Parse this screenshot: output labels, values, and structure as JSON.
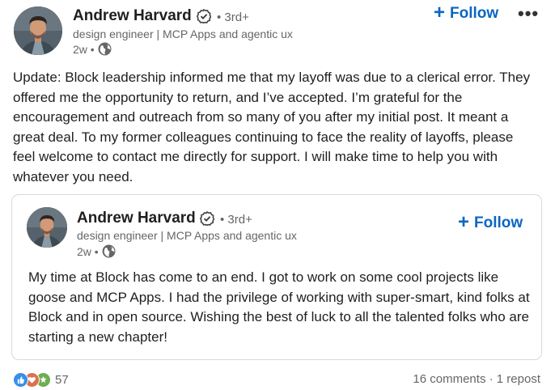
{
  "post": {
    "author": {
      "name": "Andrew Harvard",
      "degree": "• 3rd+",
      "headline": "design engineer | MCP Apps and agentic ux",
      "time": "2w •"
    },
    "follow_label": "Follow",
    "more_label": "•••",
    "text": "Update: Block leadership informed me that my layoff was due to a clerical error. They offered me the opportunity to return, and I’ve accepted. I’m grateful for the encouragement and outreach from so many of you after my initial post. It meant a great deal. To my former colleagues continuing to face the reality of layoffs, please feel welcome to contact me directly for support. I will make time to help you with whatever you need."
  },
  "shared_post": {
    "author": {
      "name": "Andrew Harvard",
      "degree": "• 3rd+",
      "headline": "design engineer | MCP Apps and agentic ux",
      "time": "2w •"
    },
    "follow_label": "Follow",
    "text": "My time at Block has come to an end. I got to work on some cool projects like goose and MCP Apps. I had the privilege of working with super-smart, kind folks at Block and in open source. Wishing the best of luck to all the talented folks who are starting a new chapter!"
  },
  "social": {
    "reaction_icons": [
      "like-icon",
      "love-icon",
      "support-icon"
    ],
    "reaction_count": "57",
    "comments": "16 comments",
    "separator": " · ",
    "reposts": "1 repost"
  },
  "colors": {
    "accent": "#0a66c2",
    "secondary_text": "#666666",
    "like": "#378fe9",
    "love": "#df704d",
    "support": "#6dae4f"
  }
}
